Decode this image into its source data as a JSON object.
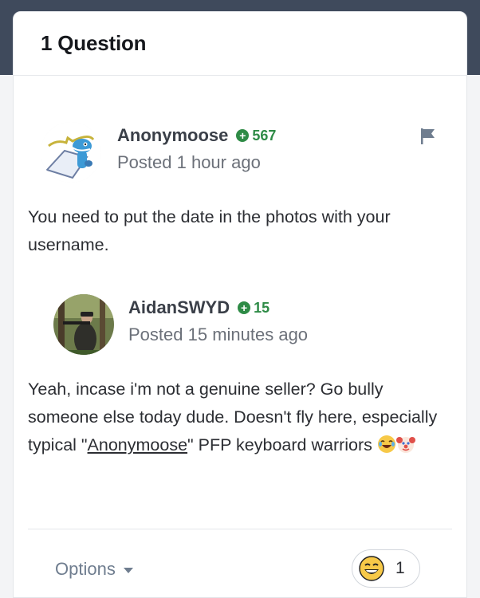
{
  "header": {
    "title": "1 Question"
  },
  "posts": [
    {
      "author": "Anonymoose",
      "reputation": "567",
      "posted": "Posted 1 hour ago",
      "body": "You need to put the date in the photos with your username."
    },
    {
      "author": "AidanSWYD",
      "reputation": "15",
      "posted": "Posted 15 minutes ago",
      "body_before_link": "Yeah, incase i'm not a genuine seller? Go bully someone else today dude. Doesn't fly here, especially typical \"",
      "body_link": "Anonymoose",
      "body_after_link": "\" PFP keyboard warriors "
    }
  ],
  "footer": {
    "options_label": "Options",
    "reaction_count": "1"
  },
  "colors": {
    "reputation_green": "#2e8b46",
    "background": "#3f4a5c"
  },
  "icons": [
    "flag-icon",
    "reputation-plus-icon",
    "chevron-down-icon",
    "laughing-emoji-icon",
    "clown-emoji-icon",
    "grinning-emoji-icon"
  ]
}
